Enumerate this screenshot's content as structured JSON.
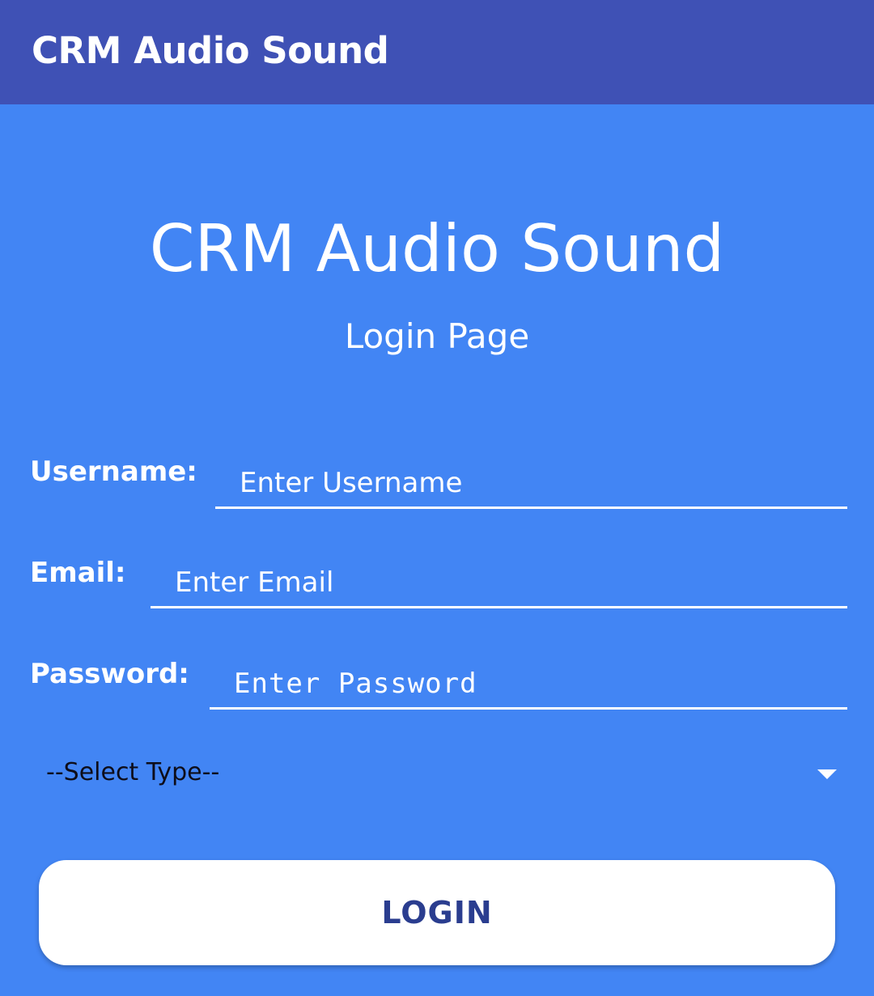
{
  "appbar": {
    "title": "CRM Audio Sound"
  },
  "main": {
    "heading": "CRM Audio Sound",
    "subheading": "Login Page"
  },
  "form": {
    "username": {
      "label": "Username:",
      "value": "",
      "placeholder": "Enter Username"
    },
    "email": {
      "label": "Email:",
      "value": "",
      "placeholder": "Enter Email"
    },
    "password": {
      "label": "Password:",
      "value": "",
      "placeholder": "Enter Password"
    },
    "type_select": {
      "selected": "--Select Type--",
      "icon": "dropdown-caret-icon"
    },
    "login_label": "LOGIN"
  },
  "colors": {
    "appbar": "#3f51b5",
    "background": "#4285f4",
    "button_background": "#ffffff",
    "button_text": "#2a3d8f"
  }
}
